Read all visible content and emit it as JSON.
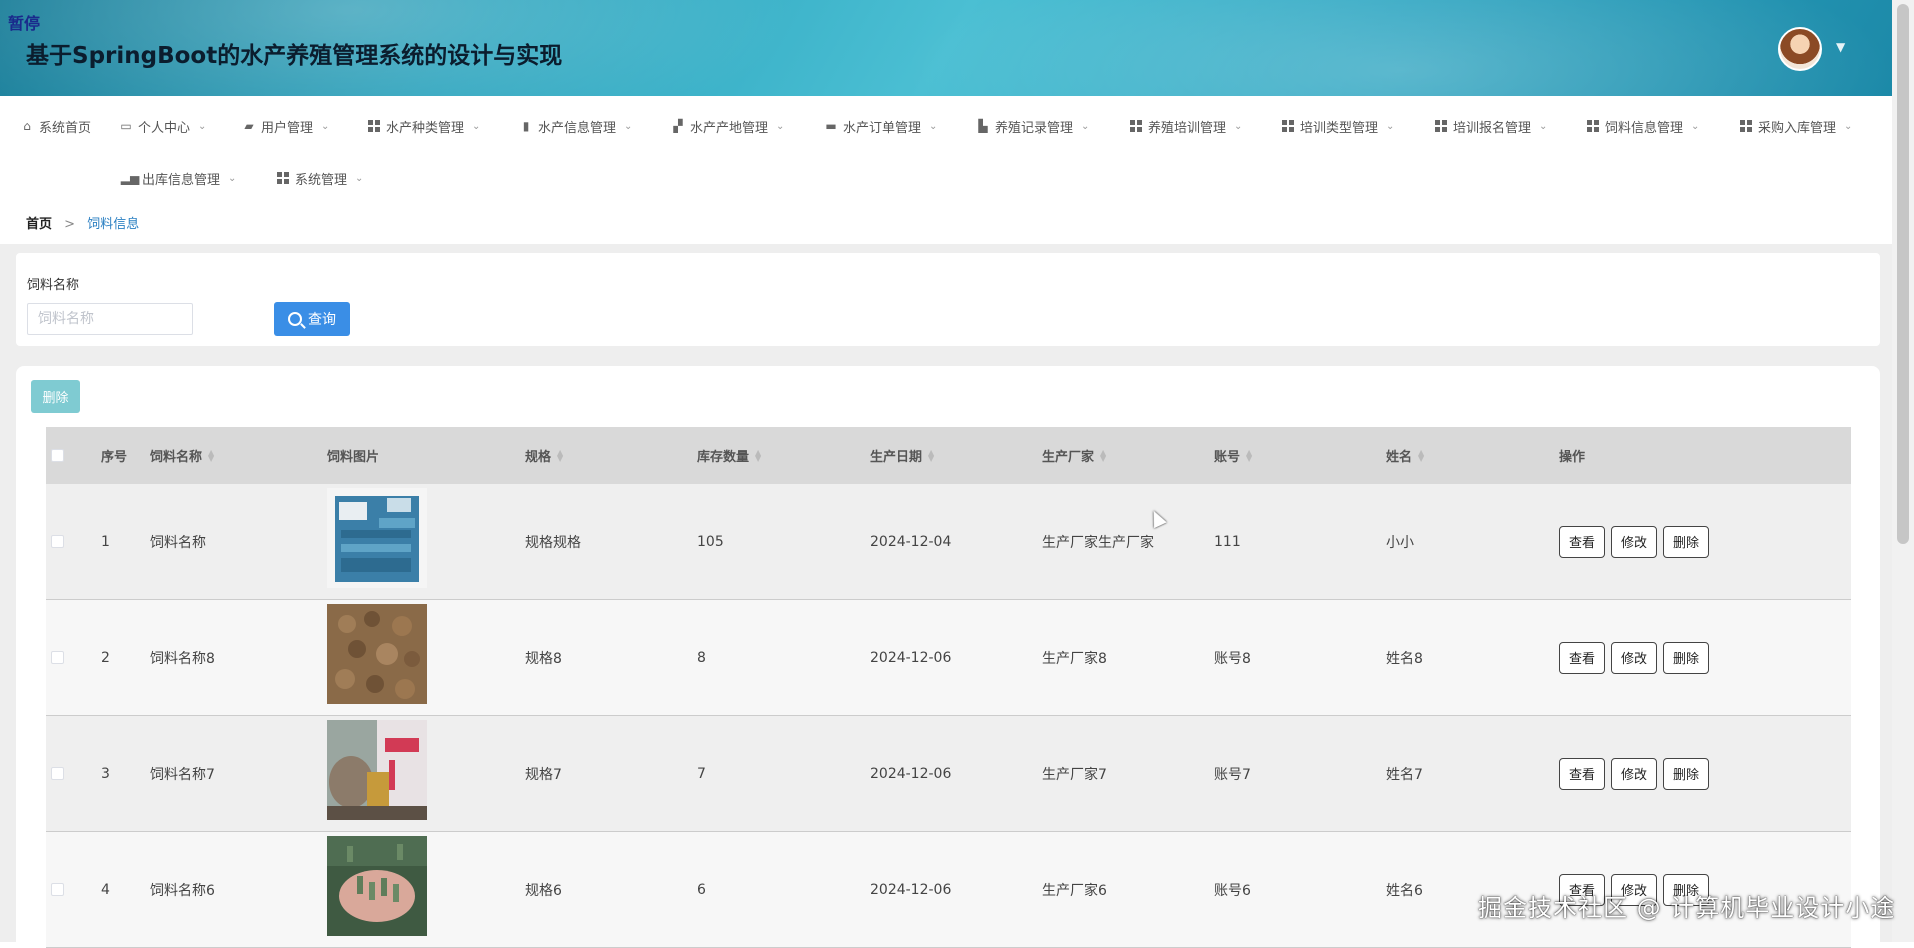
{
  "header": {
    "pause_tag": "暂停",
    "title": "基于SpringBoot的水产养殖管理系统的设计与实现"
  },
  "nav": {
    "items": [
      {
        "label": "系统首页",
        "icon": "home-icon"
      },
      {
        "label": "个人中心",
        "icon": "card-icon"
      },
      {
        "label": "用户管理",
        "icon": "chat-icon"
      },
      {
        "label": "水产种类管理",
        "icon": "grid-icon"
      },
      {
        "label": "水产信息管理",
        "icon": "clipboard-icon"
      },
      {
        "label": "水产产地管理",
        "icon": "ticket-icon"
      },
      {
        "label": "水产订单管理",
        "icon": "briefcase-icon"
      },
      {
        "label": "养殖记录管理",
        "icon": "chart-icon"
      },
      {
        "label": "养殖培训管理",
        "icon": "grid-icon"
      },
      {
        "label": "培训类型管理",
        "icon": "grid-icon"
      },
      {
        "label": "培训报名管理",
        "icon": "grid-icon"
      },
      {
        "label": "饲料信息管理",
        "icon": "grid-icon"
      },
      {
        "label": "采购入库管理",
        "icon": "grid-icon"
      },
      {
        "label": "出库信息管理",
        "icon": "bar-chart-icon"
      },
      {
        "label": "系统管理",
        "icon": "grid-icon"
      }
    ]
  },
  "breadcrumb": {
    "home": "首页",
    "separator": ">",
    "current": "饲料信息"
  },
  "search": {
    "label": "饲料名称",
    "placeholder": "饲料名称",
    "button": "查询"
  },
  "toolbar": {
    "batch_delete": "删除"
  },
  "table": {
    "headers": {
      "index": "序号",
      "name": "饲料名称",
      "image": "饲料图片",
      "spec": "规格",
      "stock": "库存数量",
      "date": "生产日期",
      "maker": "生产厂家",
      "account": "账号",
      "person": "姓名",
      "actions": "操作"
    },
    "rows": [
      {
        "index": "1",
        "name": "饲料名称",
        "spec": "规格规格",
        "stock": "105",
        "date": "2024-12-04",
        "maker": "生产厂家生产厂家",
        "account": "111",
        "person": "小小"
      },
      {
        "index": "2",
        "name": "饲料名称8",
        "spec": "规格8",
        "stock": "8",
        "date": "2024-12-06",
        "maker": "生产厂家8",
        "account": "账号8",
        "person": "姓名8"
      },
      {
        "index": "3",
        "name": "饲料名称7",
        "spec": "规格7",
        "stock": "7",
        "date": "2024-12-06",
        "maker": "生产厂家7",
        "account": "账号7",
        "person": "姓名7"
      },
      {
        "index": "4",
        "name": "饲料名称6",
        "spec": "规格6",
        "stock": "6",
        "date": "2024-12-06",
        "maker": "生产厂家6",
        "account": "账号6",
        "person": "姓名6"
      }
    ],
    "row_actions": {
      "view": "查看",
      "edit": "修改",
      "delete": "删除"
    }
  },
  "watermark": "掘金技术社区 @ 计算机毕业设计小途",
  "colors": {
    "primary": "#3a8ee6",
    "batch_delete": "#7fcbd2",
    "breadcrumb_current": "#2a7fc2",
    "table_header": "#d9d9d9"
  }
}
